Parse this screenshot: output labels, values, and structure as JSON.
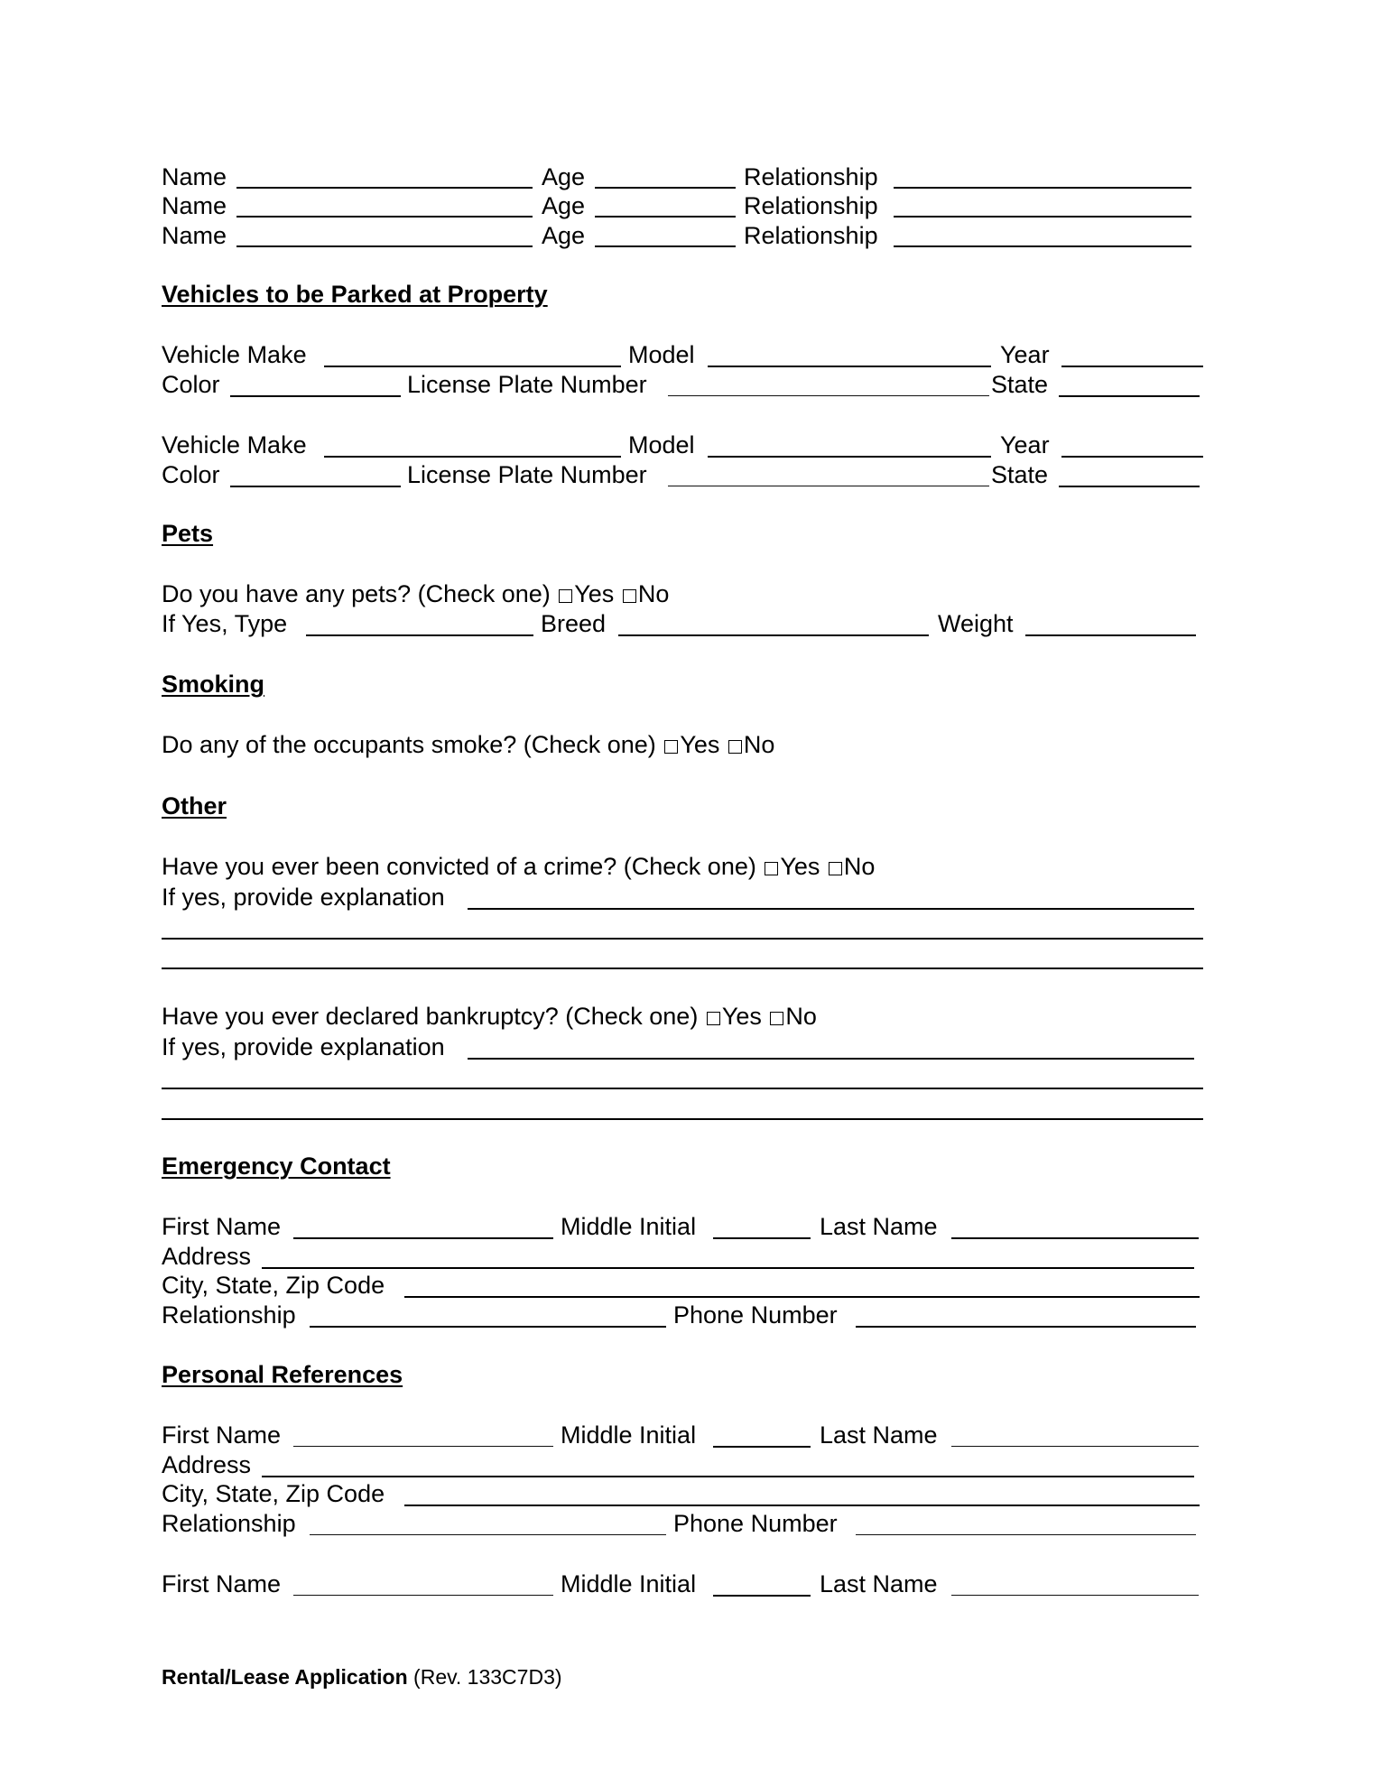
{
  "occupants": {
    "rows": [
      {
        "name_label": "Name",
        "age_label": "Age",
        "relationship_label": "Relationship"
      },
      {
        "name_label": "Name",
        "age_label": "Age",
        "relationship_label": "Relationship"
      },
      {
        "name_label": "Name",
        "age_label": "Age",
        "relationship_label": "Relationship"
      }
    ]
  },
  "vehicles": {
    "heading": "Vehicles to be Parked at Property",
    "entries": [
      {
        "make_label": "Vehicle Make",
        "model_label": "Model",
        "year_label": "Year",
        "color_label": "Color",
        "plate_label": "License Plate Number",
        "state_label": "State"
      },
      {
        "make_label": "Vehicle Make",
        "model_label": "Model",
        "year_label": "Year",
        "color_label": "Color",
        "plate_label": "License Plate Number",
        "state_label": "State"
      }
    ]
  },
  "pets": {
    "heading": "Pets",
    "question": "Do you have any pets? (Check one)",
    "yes_label": "Yes",
    "no_label": "No",
    "type_label": "If Yes, Type",
    "breed_label": "Breed",
    "weight_label": "Weight"
  },
  "smoking": {
    "heading": "Smoking",
    "question": "Do any of the occupants smoke? (Check one)",
    "yes_label": "Yes",
    "no_label": "No"
  },
  "other": {
    "heading": "Other",
    "crime_question": "Have you ever been convicted of a crime? (Check one)",
    "bankruptcy_question": "Have you ever declared bankruptcy? (Check one)",
    "yes_label": "Yes",
    "no_label": "No",
    "explanation_label": "If yes, provide explanation"
  },
  "emergency_contact": {
    "heading": "Emergency Contact",
    "first_name_label": "First Name",
    "middle_initial_label": "Middle Initial",
    "last_name_label": "Last Name",
    "address_label": "Address",
    "city_label": "City, State, Zip Code",
    "relationship_label": "Relationship",
    "phone_label": "Phone Number"
  },
  "references": {
    "heading": "Personal References",
    "first_name_label": "First Name",
    "middle_initial_label": "Middle Initial",
    "last_name_label": "Last Name",
    "address_label": "Address",
    "city_label": "City, State, Zip Code",
    "relationship_label": "Relationship",
    "phone_label": "Phone Number"
  },
  "footer": {
    "title": "Rental/Lease Application",
    "revision": "(Rev. 133C7D3)"
  }
}
